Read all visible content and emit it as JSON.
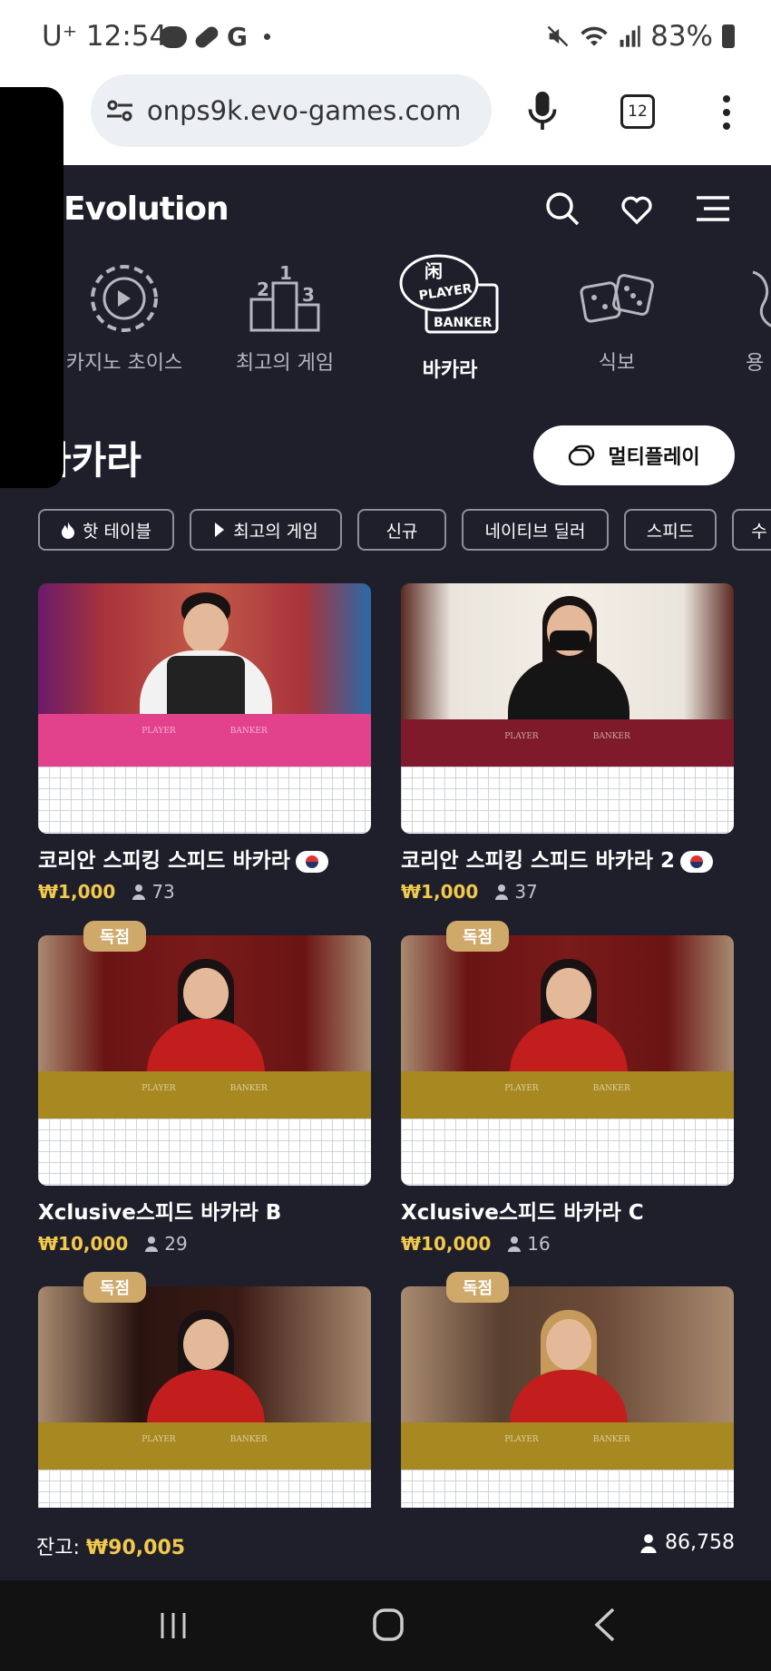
{
  "status_bar": {
    "time": "12:54",
    "carrier": "U⁺",
    "battery": "83%"
  },
  "browser": {
    "url": "onps9k.evo-games.com",
    "tab_count": "12"
  },
  "header": {
    "brand": "Evolution"
  },
  "categories": [
    {
      "label": "카지노 초이스"
    },
    {
      "label": "최고의 게임"
    },
    {
      "label": "바카라"
    },
    {
      "label": "식보"
    },
    {
      "label": "용"
    }
  ],
  "section": {
    "title": "바카라",
    "multiplay_label": "멀티플레이"
  },
  "filters": [
    "핫 테이블",
    "최고의 게임",
    "신규",
    "네이티브 딜러",
    "스피드",
    "수"
  ],
  "cards": [
    {
      "title": "코리안 스피킹 스피드 바카라",
      "price": "₩1,000",
      "players": "73",
      "badge": ""
    },
    {
      "title": "코리안 스피킹 스피드 바카라 2",
      "price": "₩1,000",
      "players": "37",
      "badge": ""
    },
    {
      "title": "Xclusive스피드 바카라 B",
      "price": "₩10,000",
      "players": "29",
      "badge": "독점"
    },
    {
      "title": "Xclusive스피드 바카라 C",
      "price": "₩10,000",
      "players": "16",
      "badge": "독점"
    },
    {
      "title": "",
      "price": "",
      "players": "",
      "badge": "독점"
    },
    {
      "title": "",
      "price": "",
      "players": "",
      "badge": "독점"
    }
  ],
  "footer": {
    "balance_label": "잔고:",
    "balance_value": "₩90,005",
    "online_count": "86,758"
  },
  "table_labels": {
    "player": "PLAYER",
    "banker": "BANKER"
  },
  "colors": {
    "background": "#1e1f2b",
    "price": "#f2c94c",
    "badge": "#cfa96a"
  }
}
